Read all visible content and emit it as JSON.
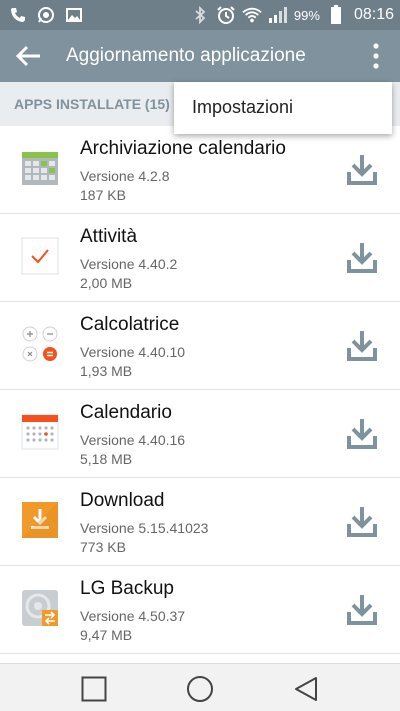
{
  "status_bar": {
    "battery_percent": "99%",
    "time": "08:16",
    "left_icons": [
      "phone-icon",
      "whatsapp-icon",
      "gallery-icon"
    ],
    "right_icons": [
      "bluetooth-icon",
      "alarm-icon",
      "wifi-icon",
      "signal-icon",
      "battery-icon"
    ]
  },
  "app_bar": {
    "title": "Aggiornamento applicazione",
    "background": "#7f929d"
  },
  "section": {
    "header": "APPS INSTALLATE (15)"
  },
  "menu": {
    "items": [
      {
        "label": "Impostazioni"
      }
    ]
  },
  "apps": [
    {
      "name": "Archiviazione calendario",
      "version": "Versione 4.2.8",
      "size": "187 KB",
      "icon": "calendar-archive-icon"
    },
    {
      "name": "Attività",
      "version": "Versione 4.40.2",
      "size": "2,00 MB",
      "icon": "tasks-icon"
    },
    {
      "name": "Calcolatrice",
      "version": "Versione 4.40.10",
      "size": "1,93 MB",
      "icon": "calculator-icon"
    },
    {
      "name": "Calendario",
      "version": "Versione 4.40.16",
      "size": "5,18 MB",
      "icon": "calendar-icon"
    },
    {
      "name": "Download",
      "version": "Versione 5.15.41023",
      "size": "773 KB",
      "icon": "download-app-icon"
    },
    {
      "name": "LG Backup",
      "version": "Versione 4.50.37",
      "size": "9,47 MB",
      "icon": "backup-icon"
    }
  ],
  "nav_bar": {
    "buttons": [
      "recent-apps-button",
      "home-button",
      "back-nav-button"
    ]
  }
}
